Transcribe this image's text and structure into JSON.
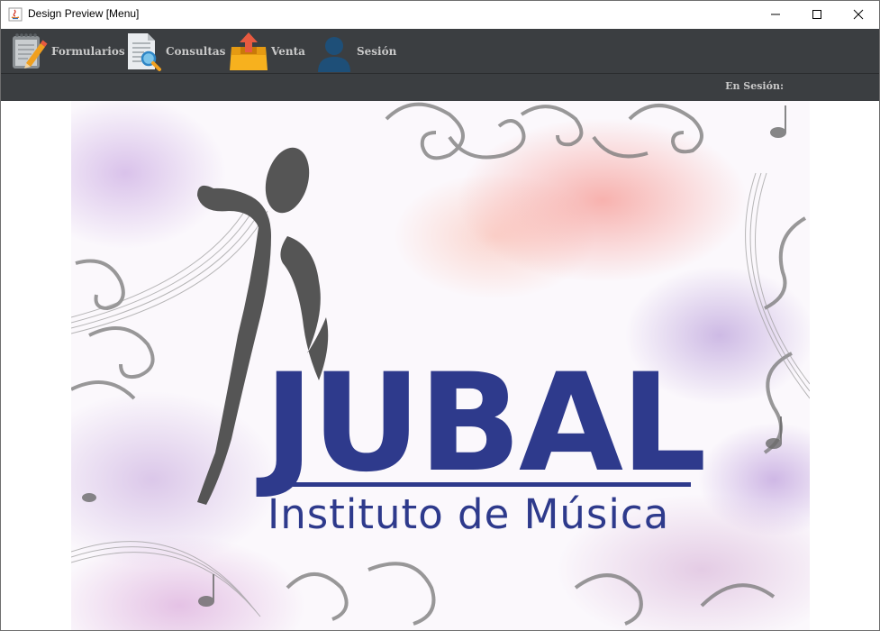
{
  "window": {
    "title": "Design Preview [Menu]",
    "controls": [
      "minimize",
      "maximize",
      "close"
    ]
  },
  "toolbar": {
    "items": [
      {
        "label": "Formularios",
        "icon": "notepad-pencil-icon"
      },
      {
        "label": "Consultas",
        "icon": "document-search-icon"
      },
      {
        "label": "Venta",
        "icon": "box-upload-icon"
      },
      {
        "label": "Sesión",
        "icon": "user-icon"
      }
    ]
  },
  "status": {
    "session_label": "En Sesión:"
  },
  "banner": {
    "title": "JUBAL",
    "subtitle": "Instituto de Música",
    "brand_color": "#2e3a8c",
    "logo_figure_color": "#555555"
  },
  "colors": {
    "toolbar_bg": "#3b3e41",
    "toolbar_text": "#c9c9c9"
  }
}
